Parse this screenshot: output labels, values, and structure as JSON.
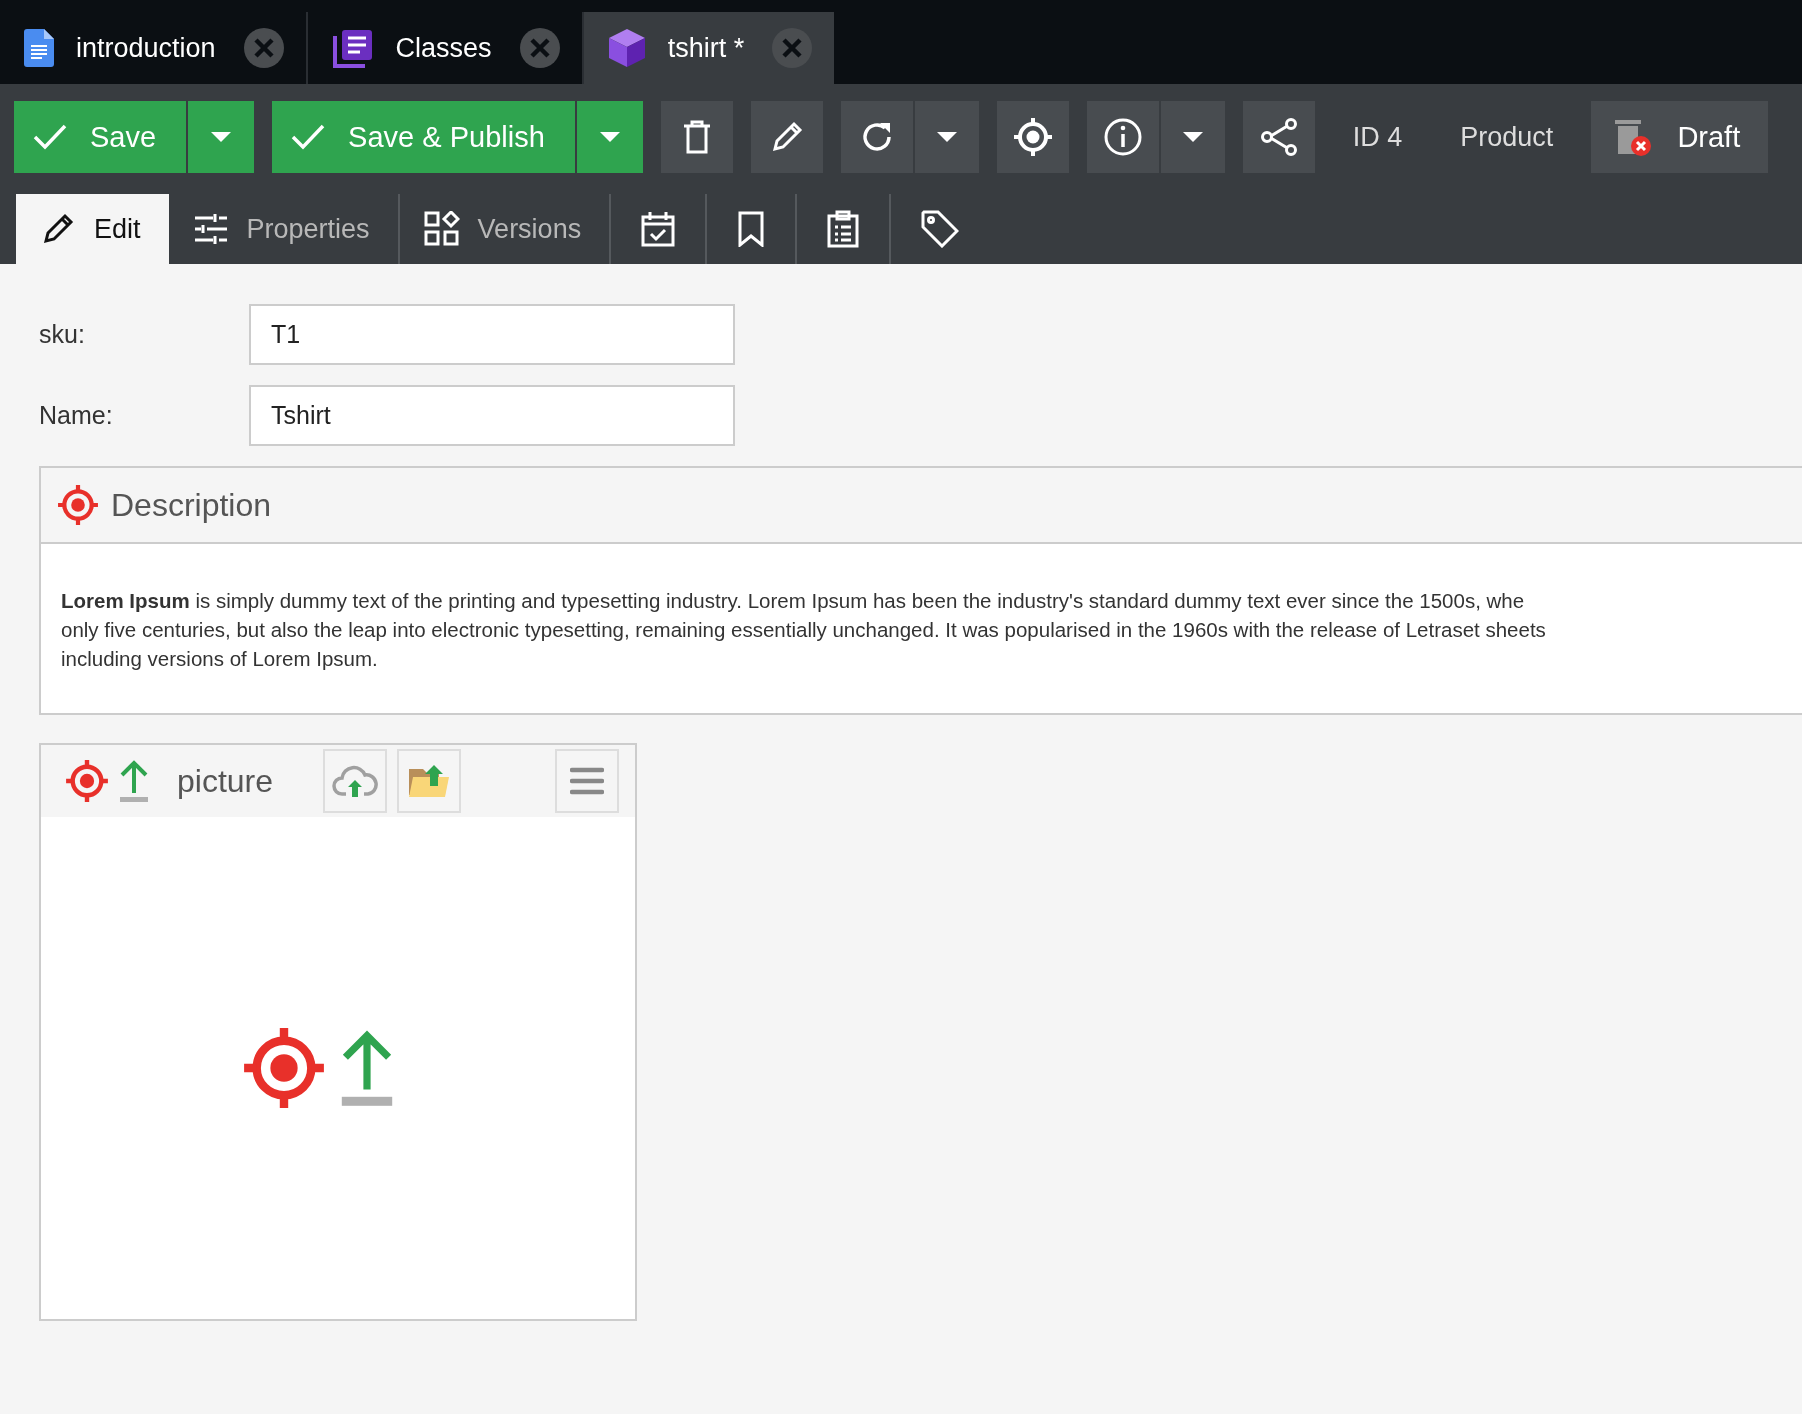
{
  "editor_tabs": [
    {
      "label": "introduction",
      "kind": "document",
      "selected": false
    },
    {
      "label": "Classes",
      "kind": "classes",
      "selected": false
    },
    {
      "label": "tshirt *",
      "kind": "cube",
      "selected": true
    }
  ],
  "toolbar": {
    "save": "Save",
    "save_publish": "Save & Publish",
    "id": "ID 4",
    "class_name": "Product",
    "status": "Draft"
  },
  "subtabs": [
    {
      "label": "Edit",
      "kind": "pencil",
      "selected": true
    },
    {
      "label": "Properties",
      "kind": "sliders",
      "selected": false
    },
    {
      "label": "Versions",
      "kind": "shapes",
      "selected": false
    },
    {
      "kind": "calendar",
      "selected": false
    },
    {
      "kind": "bookmark",
      "selected": false
    },
    {
      "kind": "clipboard",
      "selected": false
    },
    {
      "kind": "tag",
      "selected": false
    }
  ],
  "fields": [
    {
      "label": "sku:",
      "value": "T1"
    },
    {
      "label": "Name:",
      "value": "Tshirt"
    }
  ],
  "description": {
    "title": "Description",
    "lines": [
      "**Lorem Ipsum** is simply dummy text of the printing and typesetting industry. Lorem Ipsum has been the industry's standard dummy text ever since the 1500s, whe",
      "only five centuries, but also the leap into electronic typesetting, remaining essentially unchanged. It was popularised in the 1960s with the release of Letraset sheets",
      "including versions of Lorem Ipsum."
    ]
  },
  "picture": {
    "title": "picture"
  }
}
